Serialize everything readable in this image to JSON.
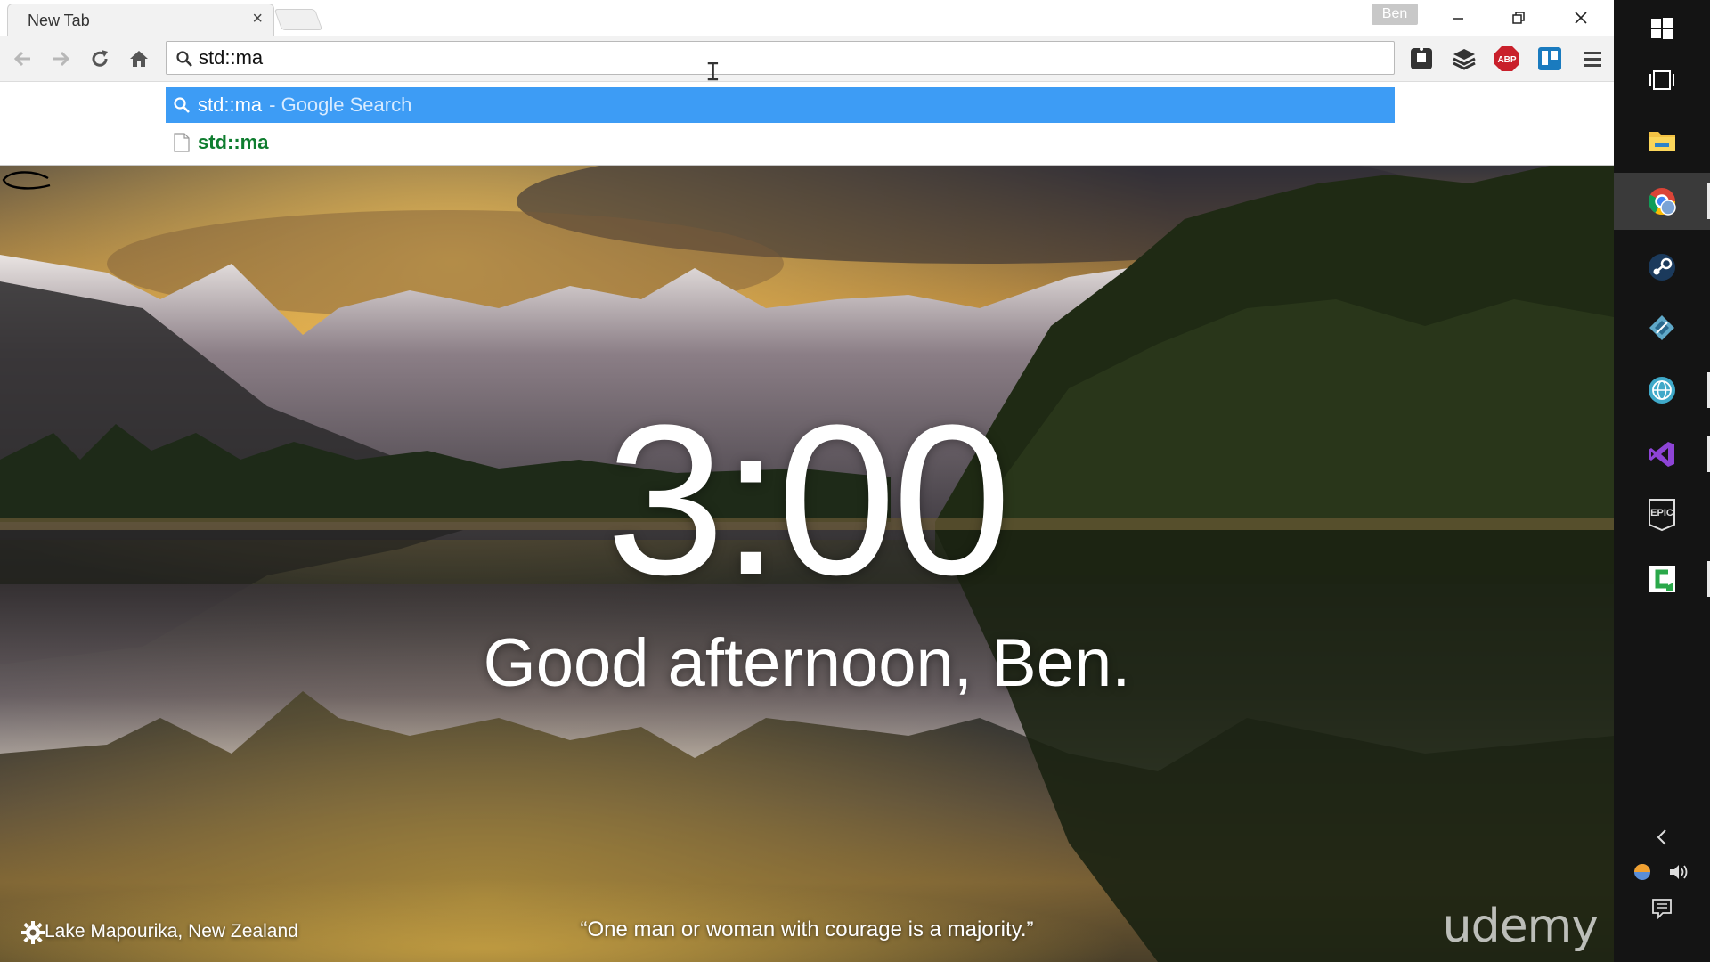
{
  "tab": {
    "title": "New Tab",
    "close_glyph": "×"
  },
  "profile": {
    "name": "Ben"
  },
  "omnibox": {
    "value": "std::ma"
  },
  "suggestions": [
    {
      "text": "std::ma",
      "description": "- Google Search",
      "icon": "search-icon"
    },
    {
      "text": "std::ma",
      "icon": "page-icon"
    }
  ],
  "extensions": [
    "puzzle-extension-icon",
    "layers-extension-icon",
    "adblock-plus-icon",
    "trello-icon",
    "menu-icon"
  ],
  "adblock_label": "ABP",
  "momentum": {
    "time": "3:00",
    "greeting": "Good afternoon, Ben.",
    "location": "Lake Mapourika, New Zealand",
    "quote": "“One man or woman with courage is a majority.”"
  },
  "watermark": "udemy",
  "taskbar": {
    "apps": [
      "windows-start-icon",
      "task-view-icon",
      "file-explorer-icon",
      "chrome-icon",
      "steam-icon",
      "app-diamond-icon",
      "globe-app-icon",
      "visual-studio-icon",
      "epic-games-icon",
      "camtasia-icon"
    ],
    "epic_label": "EPIC"
  },
  "colors": {
    "suggestion_highlight": "#3d9cf5",
    "url_suggestion": "#0f7d2f",
    "taskbar": "#141414"
  }
}
